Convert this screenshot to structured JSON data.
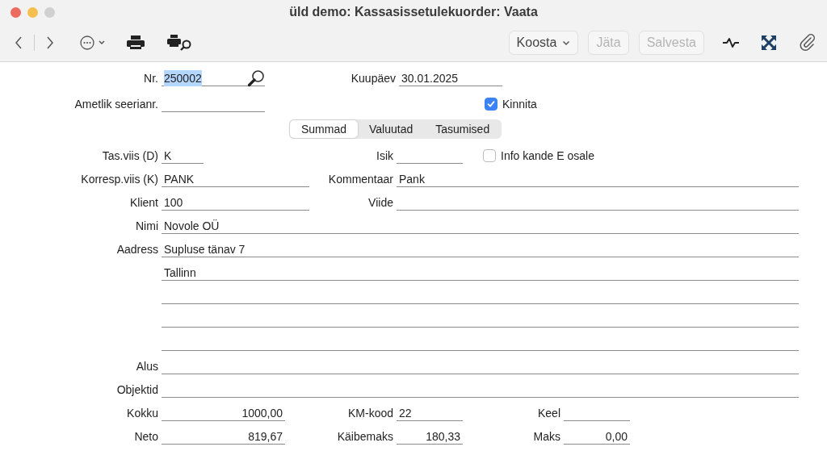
{
  "window": {
    "title": "üld demo: Kassasissetulekuorder: Vaata"
  },
  "toolbar": {
    "menu_button": "Koosta",
    "buttons": [
      {
        "label": "Jäta",
        "disabled": true
      },
      {
        "label": "Salvesta",
        "disabled": true
      }
    ]
  },
  "header": {
    "nr": {
      "label": "Nr.",
      "value": "250002",
      "text_selected": true
    },
    "date": {
      "label": "Kuupäev",
      "value": "30.01.2025"
    },
    "official_serial": {
      "label": "Ametlik seerianr."
    },
    "approve": {
      "label": "Kinnita",
      "checked": true
    }
  },
  "tabs": [
    {
      "label": "Summad",
      "selected": true
    },
    {
      "label": "Valuutad",
      "selected": false
    },
    {
      "label": "Tasumised",
      "selected": false
    }
  ],
  "form": {
    "payment_mode": {
      "label": "Tas.viis (D)",
      "value": "K"
    },
    "person": {
      "label": "Isik"
    },
    "info_e": {
      "label": "Info kande E osale",
      "checked": false
    },
    "corresp_mode": {
      "label": "Korresp.viis (K)",
      "value": "PANK"
    },
    "comment": {
      "label": "Kommentaar",
      "value": "Pank"
    },
    "client": {
      "label": "Klient",
      "value": "100"
    },
    "reference": {
      "label": "Viide"
    },
    "name": {
      "label": "Nimi",
      "value": "Novole OÜ"
    },
    "address": {
      "label": "Aadress",
      "lines": [
        "Supluse tänav 7",
        "Tallinn"
      ]
    },
    "basis": {
      "label": "Alus"
    },
    "objects": {
      "label": "Objektid"
    },
    "total": {
      "label": "Kokku",
      "value": "1000,00"
    },
    "vat_code": {
      "label": "KM-kood",
      "value": "22"
    },
    "language": {
      "label": "Keel"
    },
    "net": {
      "label": "Neto",
      "value": "819,67"
    },
    "vat": {
      "label": "Käibemaks",
      "value": "180,33"
    },
    "tax": {
      "label": "Maks",
      "value": "0,00"
    }
  }
}
